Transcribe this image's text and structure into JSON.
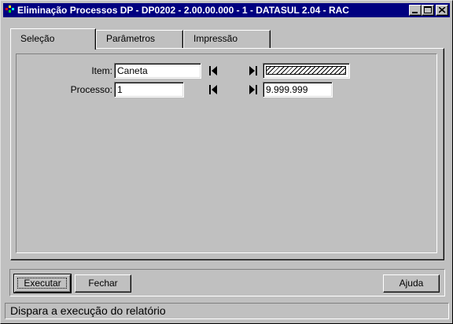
{
  "window": {
    "title": "Eliminação Processos DP - DP0202 - 2.00.00.000 - 1 - DATASUL 2.04 - RAC",
    "titlebar_color": "#000080"
  },
  "tabs": [
    {
      "label": "Seleção",
      "active": true
    },
    {
      "label": "Parâmetros",
      "active": false
    },
    {
      "label": "Impressão",
      "active": false
    }
  ],
  "selection": {
    "item": {
      "label": "Item:",
      "initial": "Caneta",
      "final": ""
    },
    "processo": {
      "label": "Processo:",
      "initial": "1",
      "final": "9.999.999"
    },
    "icons": {
      "first": "first-record-icon",
      "last": "last-record-icon"
    }
  },
  "buttons": {
    "execute": "Executar",
    "close": "Fechar",
    "help": "Ajuda"
  },
  "status": "Dispara a execução do relatório"
}
